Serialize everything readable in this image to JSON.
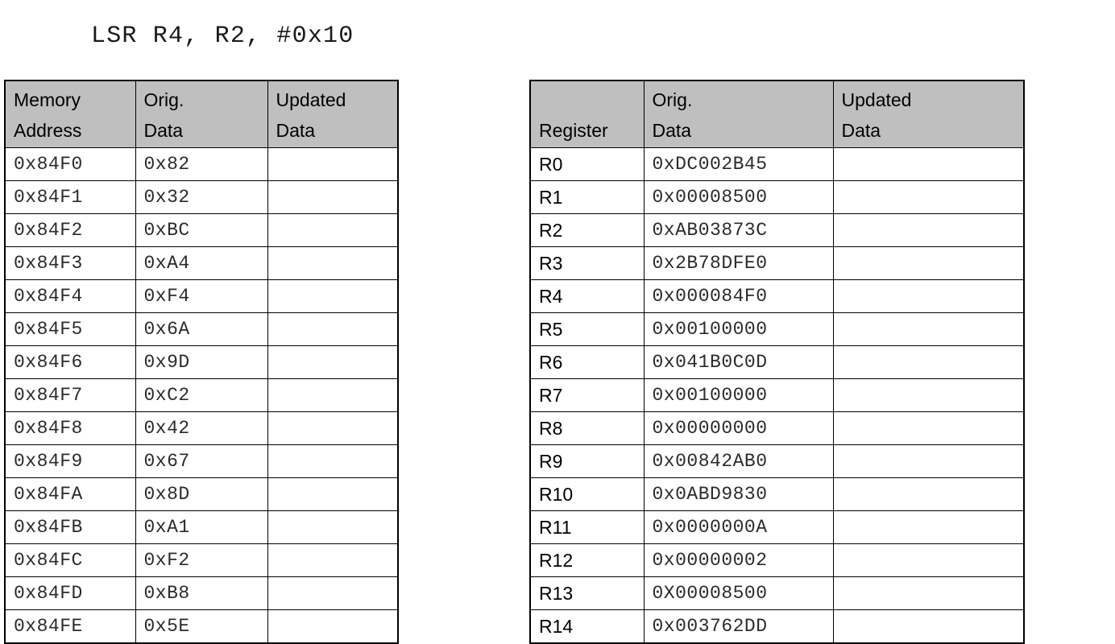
{
  "instruction": {
    "text": "LSR R4, R2, #0x10"
  },
  "memory_table": {
    "name": "memory-table",
    "headers": {
      "address_line1": "Memory",
      "address_line2": "Address",
      "orig_line1": "Orig.",
      "orig_line2": "Data",
      "updated_line1": "Updated",
      "updated_line2": "Data"
    },
    "rows": [
      {
        "address": "0x84F0",
        "orig": "0x82",
        "updated": ""
      },
      {
        "address": "0x84F1",
        "orig": "0x32",
        "updated": ""
      },
      {
        "address": "0x84F2",
        "orig": "0xBC",
        "updated": ""
      },
      {
        "address": "0x84F3",
        "orig": "0xA4",
        "updated": ""
      },
      {
        "address": "0x84F4",
        "orig": "0xF4",
        "updated": ""
      },
      {
        "address": "0x84F5",
        "orig": "0x6A",
        "updated": ""
      },
      {
        "address": "0x84F6",
        "orig": "0x9D",
        "updated": ""
      },
      {
        "address": "0x84F7",
        "orig": "0xC2",
        "updated": ""
      },
      {
        "address": "0x84F8",
        "orig": "0x42",
        "updated": ""
      },
      {
        "address": "0x84F9",
        "orig": "0x67",
        "updated": ""
      },
      {
        "address": "0x84FA",
        "orig": "0x8D",
        "updated": ""
      },
      {
        "address": "0x84FB",
        "orig": "0xA1",
        "updated": ""
      },
      {
        "address": "0x84FC",
        "orig": "0xF2",
        "updated": ""
      },
      {
        "address": "0x84FD",
        "orig": "0xB8",
        "updated": ""
      },
      {
        "address": "0x84FE",
        "orig": "0x5E",
        "updated": ""
      }
    ]
  },
  "register_table": {
    "name": "register-table",
    "headers": {
      "register_line1": "",
      "register_line2": "Register",
      "orig_line1": "Orig.",
      "orig_line2": "Data",
      "updated_line1": "Updated",
      "updated_line2": "Data"
    },
    "rows": [
      {
        "register": "R0",
        "orig": "0xDC002B45",
        "updated": ""
      },
      {
        "register": "R1",
        "orig": "0x00008500",
        "updated": ""
      },
      {
        "register": "R2",
        "orig": "0xAB03873C",
        "updated": ""
      },
      {
        "register": "R3",
        "orig": "0x2B78DFE0",
        "updated": ""
      },
      {
        "register": "R4",
        "orig": "0x000084F0",
        "updated": ""
      },
      {
        "register": "R5",
        "orig": "0x00100000",
        "updated": ""
      },
      {
        "register": "R6",
        "orig": "0x041B0C0D",
        "updated": ""
      },
      {
        "register": "R7",
        "orig": "0x00100000",
        "updated": ""
      },
      {
        "register": "R8",
        "orig": "0x00000000",
        "updated": ""
      },
      {
        "register": "R9",
        "orig": "0x00842AB0",
        "updated": ""
      },
      {
        "register": "R10",
        "orig": "0x0ABD9830",
        "updated": ""
      },
      {
        "register": "R11",
        "orig": "0x0000000A",
        "updated": ""
      },
      {
        "register": "R12",
        "orig": "0x00000002",
        "updated": ""
      },
      {
        "register": "R13",
        "orig": "0X00008500",
        "updated": ""
      },
      {
        "register": "R14",
        "orig": "0x003762DD",
        "updated": ""
      }
    ]
  },
  "colors": {
    "header_fill": "#BFBFBF",
    "border": "#000000",
    "value_text": "#2B2B2B",
    "page_background": "#FFFFFF"
  }
}
